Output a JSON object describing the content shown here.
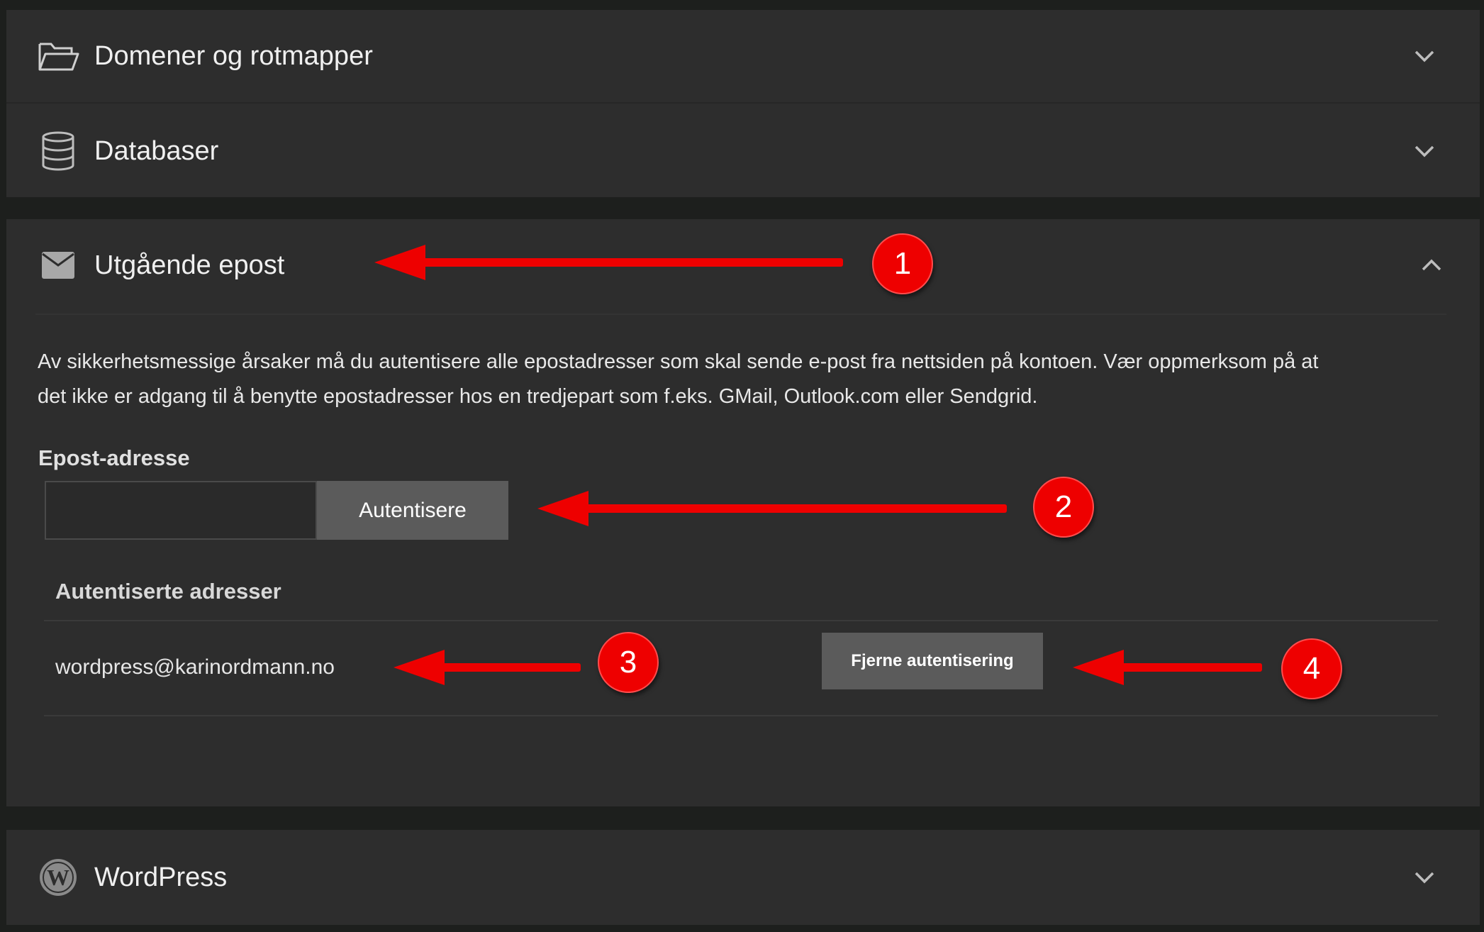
{
  "sections": {
    "domains": {
      "title": "Domener og rotmapper",
      "icon": "folder-open-icon",
      "state": "collapsed"
    },
    "databases": {
      "title": "Databaser",
      "icon": "database-icon",
      "state": "collapsed"
    },
    "outgoing_mail": {
      "title": "Utgående epost",
      "icon": "envelope-icon",
      "state": "expanded",
      "description_line1": "Av sikkerhetsmessige årsaker må du autentisere alle epostadresser som skal sende e-post fra nettsiden på kontoen. Vær oppmerksom på at",
      "description_line2": "det ikke er adgang til å benytte epostadresser hos en tredjepart som f.eks. GMail, Outlook.com eller Sendgrid.",
      "email_field_label": "Epost-adresse",
      "email_field_value": "",
      "email_field_placeholder": "",
      "authenticate_button": "Autentisere",
      "authenticated_header": "Autentiserte adresser",
      "authenticated_addresses": [
        {
          "address": "wordpress@karinordmann.no",
          "remove_button": "Fjerne autentisering"
        }
      ]
    },
    "wordpress": {
      "title": "WordPress",
      "icon": "wordpress-icon",
      "state": "collapsed"
    }
  },
  "annotations": {
    "badge_1": "1",
    "badge_2": "2",
    "badge_3": "3",
    "badge_4": "4"
  },
  "colors": {
    "panel_background": "#2d2d2d",
    "page_background": "#1d1f1d",
    "button_background": "#5b5b5b",
    "annotation_red": "#ee0000"
  }
}
